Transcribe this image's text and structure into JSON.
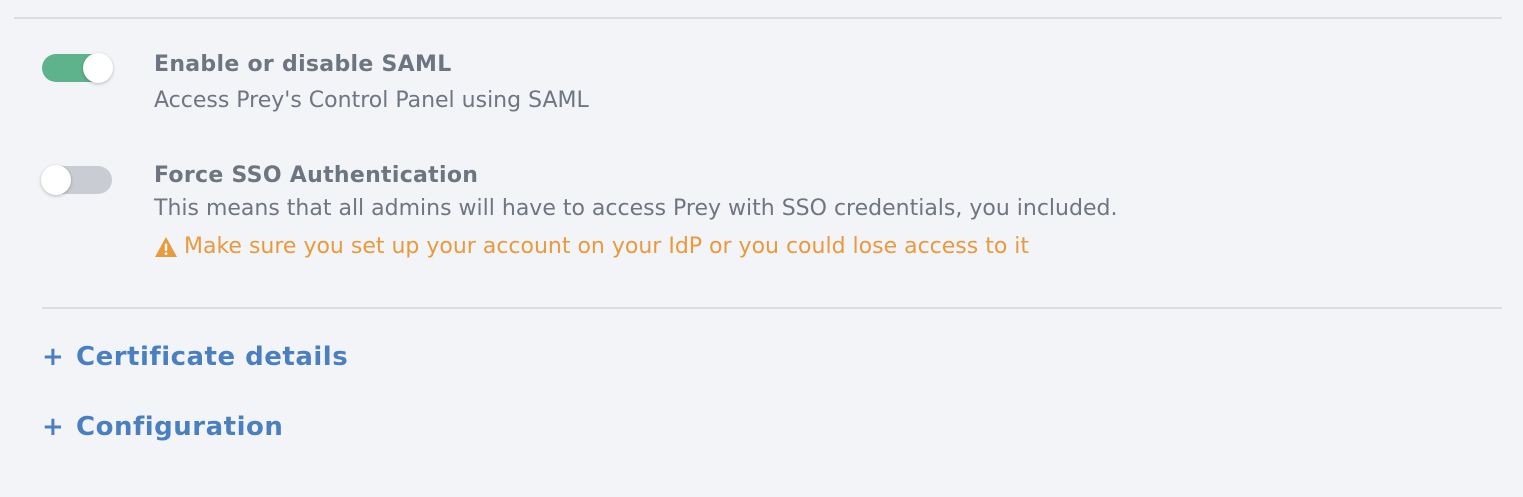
{
  "settings": {
    "saml": {
      "title": "Enable or disable SAML",
      "description": "Access Prey's Control Panel using SAML",
      "enabled": true
    },
    "force_sso": {
      "title": "Force SSO Authentication",
      "description": "This means that all admins will have to access Prey with SSO credentials, you included.",
      "warning": "Make sure you set up your account on your IdP or you could lose access to it",
      "enabled": false
    }
  },
  "sections": [
    {
      "icon": "+",
      "label": "Certificate details"
    },
    {
      "icon": "+",
      "label": "Configuration"
    }
  ],
  "colors": {
    "toggle_on": "#5eb38c",
    "toggle_off": "#c9ccd3",
    "warning": "#e89a3c",
    "link": "#4a7fc0"
  }
}
